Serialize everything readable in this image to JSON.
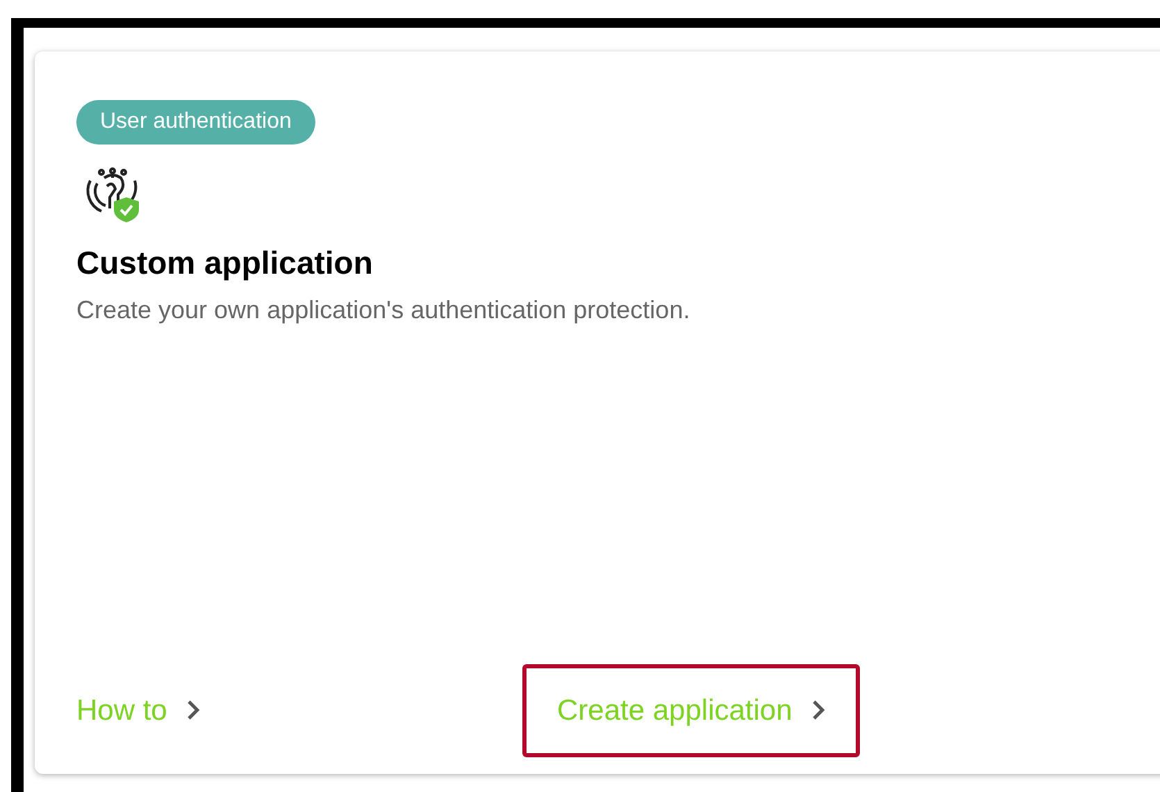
{
  "card": {
    "tag": "User authentication",
    "title": "Custom application",
    "description": "Create your own application's authentication protection.",
    "links": [
      {
        "label": "How to",
        "highlighted": false
      },
      {
        "label": "Create application",
        "highlighted": true
      }
    ]
  }
}
